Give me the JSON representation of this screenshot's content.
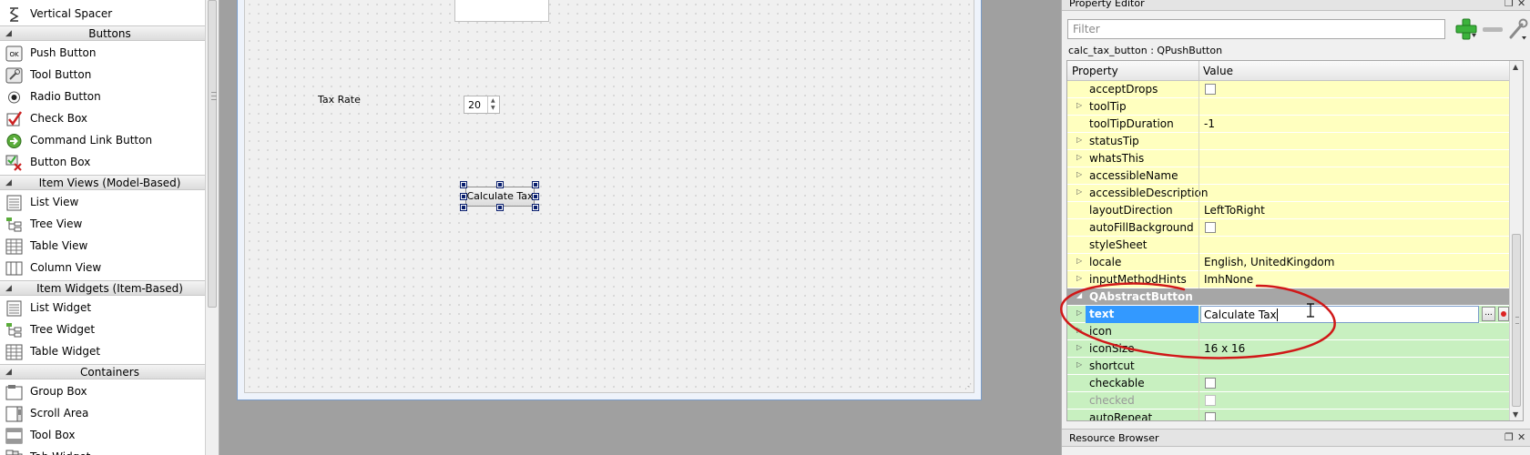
{
  "widget_box": {
    "items_top": [
      {
        "label": "Vertical Spacer",
        "icon": "vertical-spacer-icon"
      }
    ],
    "categories": [
      {
        "title": "Buttons",
        "items": [
          {
            "label": "Push Button",
            "icon": "push-button-icon",
            "icon_text": "OK"
          },
          {
            "label": "Tool Button",
            "icon": "tool-button-icon"
          },
          {
            "label": "Radio Button",
            "icon": "radio-button-icon"
          },
          {
            "label": "Check Box",
            "icon": "check-box-icon"
          },
          {
            "label": "Command Link Button",
            "icon": "command-link-button-icon"
          },
          {
            "label": "Button Box",
            "icon": "button-box-icon"
          }
        ]
      },
      {
        "title": "Item Views (Model-Based)",
        "items": [
          {
            "label": "List View",
            "icon": "list-view-icon"
          },
          {
            "label": "Tree View",
            "icon": "tree-view-icon"
          },
          {
            "label": "Table View",
            "icon": "table-view-icon"
          },
          {
            "label": "Column View",
            "icon": "column-view-icon"
          }
        ]
      },
      {
        "title": "Item Widgets (Item-Based)",
        "items": [
          {
            "label": "List Widget",
            "icon": "list-widget-icon"
          },
          {
            "label": "Tree Widget",
            "icon": "tree-widget-icon"
          },
          {
            "label": "Table Widget",
            "icon": "table-widget-icon"
          }
        ]
      },
      {
        "title": "Containers",
        "items": [
          {
            "label": "Group Box",
            "icon": "group-box-icon"
          },
          {
            "label": "Scroll Area",
            "icon": "scroll-area-icon"
          },
          {
            "label": "Tool Box",
            "icon": "tool-box-icon"
          },
          {
            "label": "Tab Widget",
            "icon": "tab-widget-icon"
          }
        ]
      }
    ]
  },
  "form": {
    "tax_rate_label": "Tax Rate",
    "tax_rate_value": "20",
    "calc_button_label": "Calculate Tax"
  },
  "property_editor": {
    "title": "Property Editor",
    "filter_placeholder": "Filter",
    "object_name": "calc_tax_button : QPushButton",
    "header_property": "Property",
    "header_value": "Value",
    "rows": [
      {
        "name": "acceptDrops",
        "kind": "checkbox",
        "color": "yellow",
        "expandable": false
      },
      {
        "name": "toolTip",
        "value": "",
        "color": "yellow",
        "expandable": true
      },
      {
        "name": "toolTipDuration",
        "value": "-1",
        "color": "yellow",
        "expandable": false
      },
      {
        "name": "statusTip",
        "value": "",
        "color": "yellow",
        "expandable": true
      },
      {
        "name": "whatsThis",
        "value": "",
        "color": "yellow",
        "expandable": true
      },
      {
        "name": "accessibleName",
        "value": "",
        "color": "yellow",
        "expandable": true
      },
      {
        "name": "accessibleDescription",
        "value": "",
        "color": "yellow",
        "expandable": true
      },
      {
        "name": "layoutDirection",
        "value": "LeftToRight",
        "color": "yellow",
        "expandable": false
      },
      {
        "name": "autoFillBackground",
        "kind": "checkbox",
        "color": "yellow",
        "expandable": false
      },
      {
        "name": "styleSheet",
        "value": "",
        "color": "yellow",
        "expandable": false
      },
      {
        "name": "locale",
        "value": "English, UnitedKingdom",
        "color": "yellow",
        "expandable": true
      },
      {
        "name": "inputMethodHints",
        "value": "ImhNone",
        "color": "yellow",
        "expandable": true
      },
      {
        "name": "QAbstractButton",
        "kind": "section",
        "color": "section",
        "expandable": true
      },
      {
        "name": "text",
        "value": "Calculate Tax",
        "kind": "editing",
        "color": "green",
        "expandable": true
      },
      {
        "name": "icon",
        "value": "",
        "color": "green",
        "expandable": true
      },
      {
        "name": "iconSize",
        "value": "16 x 16",
        "color": "green",
        "expandable": true
      },
      {
        "name": "shortcut",
        "value": "",
        "color": "green",
        "expandable": true
      },
      {
        "name": "checkable",
        "kind": "checkbox",
        "color": "green",
        "expandable": false
      },
      {
        "name": "checked",
        "kind": "checkbox-disabled",
        "color": "green",
        "expandable": false
      },
      {
        "name": "autoRepeat",
        "kind": "checkbox",
        "color": "green",
        "expandable": false
      }
    ],
    "edit_button_label": "..."
  },
  "resource_browser": {
    "title": "Resource Browser"
  },
  "colors": {
    "property_yellow": "#ffffbf",
    "property_green": "#c8f0c0",
    "section_grey": "#a6a6a6",
    "selection_blue": "#3399ff",
    "annotation_red": "#d01818"
  }
}
